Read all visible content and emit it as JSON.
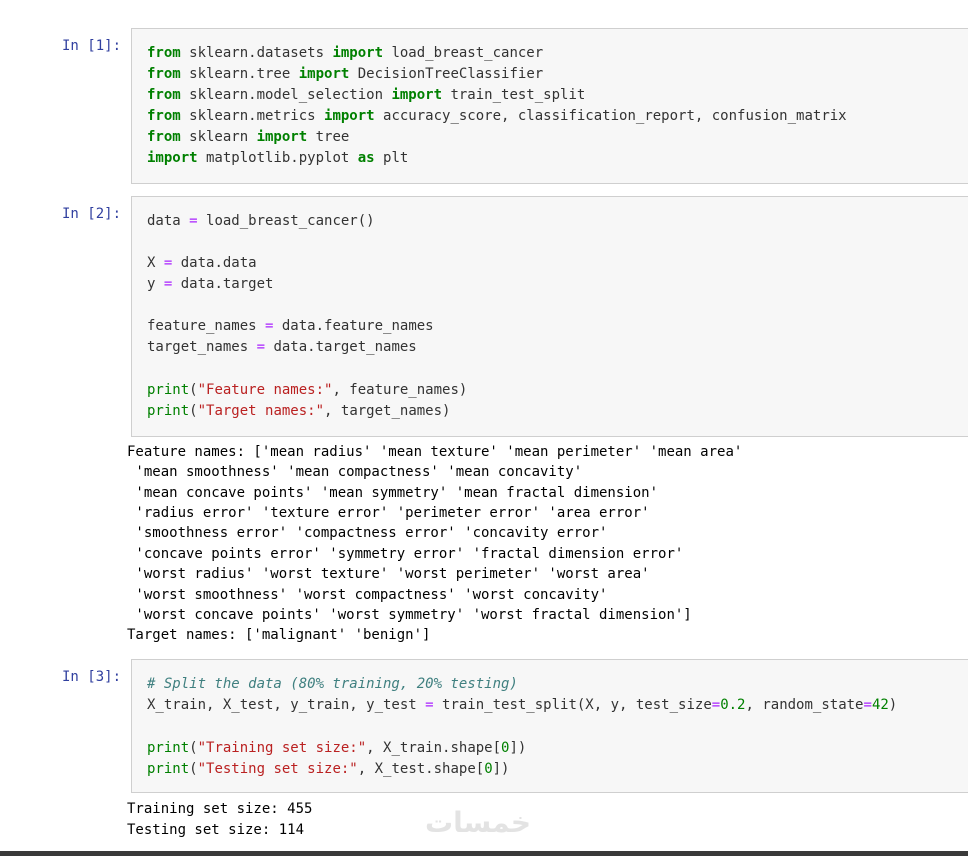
{
  "cells": [
    {
      "prompt": "In [1]:",
      "lines": [
        [
          [
            "kw",
            "from"
          ],
          [
            "nm",
            " sklearn.datasets "
          ],
          [
            "kw",
            "import"
          ],
          [
            "nm",
            " load_breast_cancer"
          ]
        ],
        [
          [
            "kw",
            "from"
          ],
          [
            "nm",
            " sklearn.tree "
          ],
          [
            "kw",
            "import"
          ],
          [
            "nm",
            " DecisionTreeClassifier"
          ]
        ],
        [
          [
            "kw",
            "from"
          ],
          [
            "nm",
            " sklearn.model_selection "
          ],
          [
            "kw",
            "import"
          ],
          [
            "nm",
            " train_test_split"
          ]
        ],
        [
          [
            "kw",
            "from"
          ],
          [
            "nm",
            " sklearn.metrics "
          ],
          [
            "kw",
            "import"
          ],
          [
            "nm",
            " accuracy_score, classification_report, confusion_matrix"
          ]
        ],
        [
          [
            "kw",
            "from"
          ],
          [
            "nm",
            " sklearn "
          ],
          [
            "kw",
            "import"
          ],
          [
            "nm",
            " tree"
          ]
        ],
        [
          [
            "kw",
            "import"
          ],
          [
            "nm",
            " matplotlib.pyplot "
          ],
          [
            "kw",
            "as"
          ],
          [
            "nm",
            " plt"
          ]
        ]
      ]
    },
    {
      "prompt": "In [2]:",
      "lines": [
        [
          [
            "nm",
            "data "
          ],
          [
            "eq",
            "="
          ],
          [
            "nm",
            " load_breast_cancer()"
          ]
        ],
        [],
        [
          [
            "nm",
            "X "
          ],
          [
            "eq",
            "="
          ],
          [
            "nm",
            " data.data"
          ]
        ],
        [
          [
            "nm",
            "y "
          ],
          [
            "eq",
            "="
          ],
          [
            "nm",
            " data.target"
          ]
        ],
        [],
        [
          [
            "nm",
            "feature_names "
          ],
          [
            "eq",
            "="
          ],
          [
            "nm",
            " data.feature_names"
          ]
        ],
        [
          [
            "nm",
            "target_names "
          ],
          [
            "eq",
            "="
          ],
          [
            "nm",
            " data.target_names"
          ]
        ],
        [],
        [
          [
            "fn",
            "print"
          ],
          [
            "nm",
            "("
          ],
          [
            "str",
            "\"Feature names:\""
          ],
          [
            "nm",
            ", feature_names)"
          ]
        ],
        [
          [
            "fn",
            "print"
          ],
          [
            "nm",
            "("
          ],
          [
            "str",
            "\"Target names:\""
          ],
          [
            "nm",
            ", target_names)"
          ]
        ]
      ],
      "output": [
        "Feature names: ['mean radius' 'mean texture' 'mean perimeter' 'mean area'",
        " 'mean smoothness' 'mean compactness' 'mean concavity'",
        " 'mean concave points' 'mean symmetry' 'mean fractal dimension'",
        " 'radius error' 'texture error' 'perimeter error' 'area error'",
        " 'smoothness error' 'compactness error' 'concavity error'",
        " 'concave points error' 'symmetry error' 'fractal dimension error'",
        " 'worst radius' 'worst texture' 'worst perimeter' 'worst area'",
        " 'worst smoothness' 'worst compactness' 'worst concavity'",
        " 'worst concave points' 'worst symmetry' 'worst fractal dimension']",
        "Target names: ['malignant' 'benign']"
      ]
    },
    {
      "prompt": "In [3]:",
      "lines": [
        [
          [
            "cm",
            "# Split the data (80% training, 20% testing)"
          ]
        ],
        [
          [
            "nm",
            "X_train, X_test, y_train, y_test "
          ],
          [
            "eq",
            "="
          ],
          [
            "nm",
            " train_test_split(X, y, test_size"
          ],
          [
            "eq",
            "="
          ],
          [
            "num",
            "0.2"
          ],
          [
            "nm",
            ", random_state"
          ],
          [
            "eq",
            "="
          ],
          [
            "num",
            "42"
          ],
          [
            "nm",
            ")"
          ]
        ],
        [],
        [
          [
            "fn",
            "print"
          ],
          [
            "nm",
            "("
          ],
          [
            "str",
            "\"Training set size:\""
          ],
          [
            "nm",
            ", X_train.shape["
          ],
          [
            "num",
            "0"
          ],
          [
            "nm",
            "])"
          ]
        ],
        [
          [
            "fn",
            "print"
          ],
          [
            "nm",
            "("
          ],
          [
            "str",
            "\"Testing set size:\""
          ],
          [
            "nm",
            ", X_test.shape["
          ],
          [
            "num",
            "0"
          ],
          [
            "nm",
            "])"
          ]
        ]
      ],
      "output": [
        "Training set size: 455",
        "Testing set size: 114"
      ]
    }
  ],
  "watermark": "خمسات"
}
